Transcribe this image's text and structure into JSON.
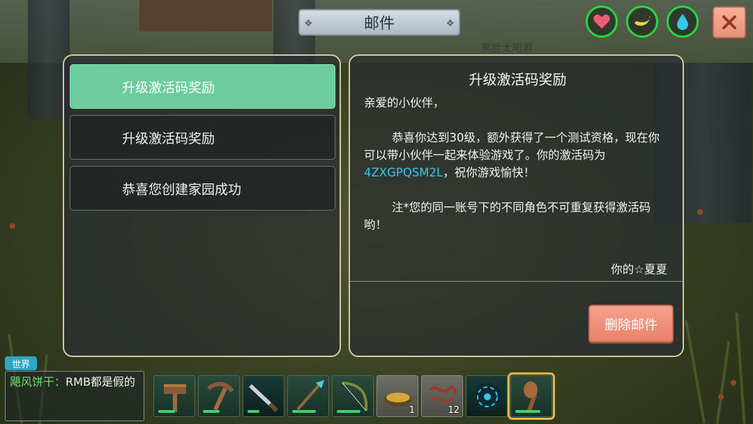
{
  "window": {
    "title": "邮件",
    "npc_name": "黑脸太阳君"
  },
  "status": {
    "health_icon": "heart-icon",
    "hunger_icon": "banana-icon",
    "thirst_icon": "water-drop-icon",
    "accent": "#28d642"
  },
  "close": {
    "icon": "close-icon",
    "color": "#e9907a"
  },
  "mail_list": {
    "items": [
      {
        "label": "升级激活码奖励",
        "active": true
      },
      {
        "label": "升级激活码奖励",
        "active": false
      },
      {
        "label": "恭喜您创建家园成功",
        "active": false
      }
    ],
    "active_color": "#6ccc9c"
  },
  "mail": {
    "title": "升级激活码奖励",
    "greeting": "亲爱的小伙伴，",
    "body_1": "恭喜你达到30级，额外获得了一个测试资格，现在你可以带小伙伴一起来体验游戏了。你的激活码为",
    "code": "4ZXGPQSM2L",
    "body_1_end": "，祝你游戏愉快！",
    "note": "注*您的同一账号下的不同角色不可重复获得激活码哟！",
    "signature": "你的☆夏夏",
    "delete_label": "删除邮件",
    "code_color": "#36c6f4"
  },
  "chat": {
    "channel": "世界",
    "sender": "飓风饼干：",
    "message": "RMB都是假的"
  },
  "hotbar": {
    "slots": [
      {
        "icon": "hammer-icon",
        "durability": 0.5
      },
      {
        "icon": "pickaxe-icon",
        "durability": 0.5
      },
      {
        "icon": "sword-icon",
        "durability": 0.35
      },
      {
        "icon": "spear-icon",
        "durability": 0.7
      },
      {
        "icon": "bow-icon",
        "durability": 0.7
      },
      {
        "icon": "seeds-icon",
        "count": "1"
      },
      {
        "icon": "rope-icon",
        "count": "12"
      },
      {
        "icon": "orb-icon"
      },
      {
        "icon": "torch-icon",
        "durability": 0.75,
        "selected": true
      }
    ]
  }
}
